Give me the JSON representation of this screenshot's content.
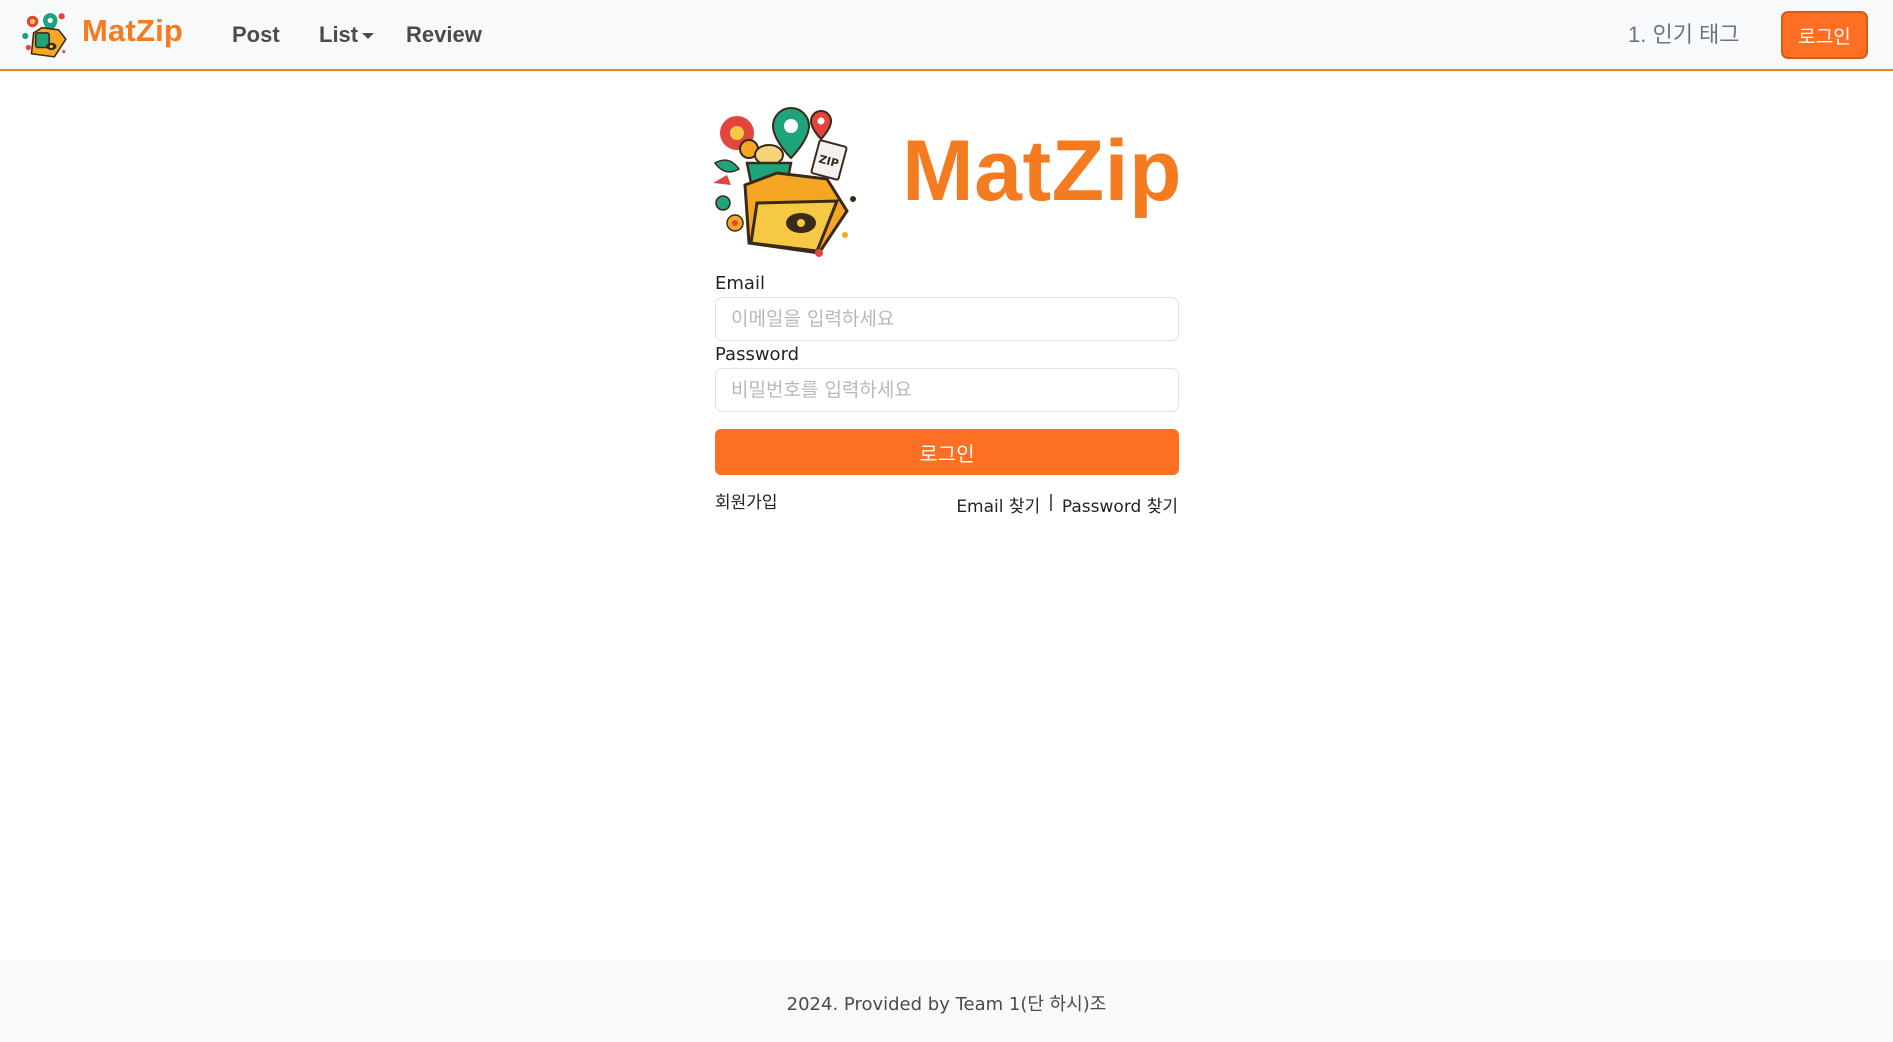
{
  "navbar": {
    "brand": "MatZip",
    "links": {
      "post": "Post",
      "list": "List",
      "review": "Review"
    },
    "popular_tag": "1. 인기 태그",
    "login_label": "로그인"
  },
  "hero": {
    "title": "MatZip"
  },
  "form": {
    "email_label": "Email",
    "email_placeholder": "이메일을 입력하세요",
    "password_label": "Password",
    "password_placeholder": "비밀번호를 입력하세요",
    "submit_label": "로그인",
    "signup_label": "회원가입",
    "find_email": "Email 찾기",
    "separator": "|",
    "find_password": "Password 찾기"
  },
  "footer": {
    "text": "2024. Provided by Team 1(단 하시)조"
  },
  "colors": {
    "accent": "#f47b20",
    "button": "#fd7023"
  }
}
